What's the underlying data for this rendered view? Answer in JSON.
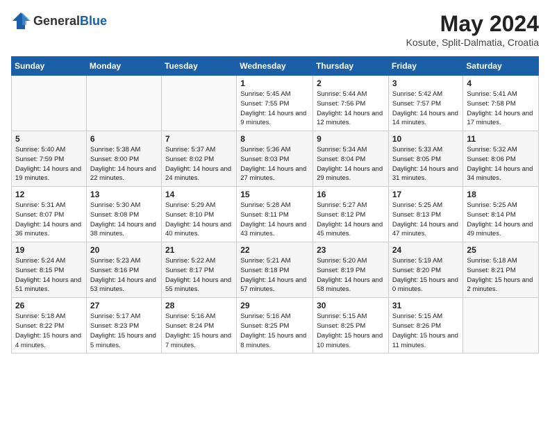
{
  "header": {
    "logo_general": "General",
    "logo_blue": "Blue",
    "month_year": "May 2024",
    "location": "Kosute, Split-Dalmatia, Croatia"
  },
  "weekdays": [
    "Sunday",
    "Monday",
    "Tuesday",
    "Wednesday",
    "Thursday",
    "Friday",
    "Saturday"
  ],
  "weeks": [
    [
      {
        "day": "",
        "info": ""
      },
      {
        "day": "",
        "info": ""
      },
      {
        "day": "",
        "info": ""
      },
      {
        "day": "1",
        "info": "Sunrise: 5:45 AM\nSunset: 7:55 PM\nDaylight: 14 hours\nand 9 minutes."
      },
      {
        "day": "2",
        "info": "Sunrise: 5:44 AM\nSunset: 7:56 PM\nDaylight: 14 hours\nand 12 minutes."
      },
      {
        "day": "3",
        "info": "Sunrise: 5:42 AM\nSunset: 7:57 PM\nDaylight: 14 hours\nand 14 minutes."
      },
      {
        "day": "4",
        "info": "Sunrise: 5:41 AM\nSunset: 7:58 PM\nDaylight: 14 hours\nand 17 minutes."
      }
    ],
    [
      {
        "day": "5",
        "info": "Sunrise: 5:40 AM\nSunset: 7:59 PM\nDaylight: 14 hours\nand 19 minutes."
      },
      {
        "day": "6",
        "info": "Sunrise: 5:38 AM\nSunset: 8:00 PM\nDaylight: 14 hours\nand 22 minutes."
      },
      {
        "day": "7",
        "info": "Sunrise: 5:37 AM\nSunset: 8:02 PM\nDaylight: 14 hours\nand 24 minutes."
      },
      {
        "day": "8",
        "info": "Sunrise: 5:36 AM\nSunset: 8:03 PM\nDaylight: 14 hours\nand 27 minutes."
      },
      {
        "day": "9",
        "info": "Sunrise: 5:34 AM\nSunset: 8:04 PM\nDaylight: 14 hours\nand 29 minutes."
      },
      {
        "day": "10",
        "info": "Sunrise: 5:33 AM\nSunset: 8:05 PM\nDaylight: 14 hours\nand 31 minutes."
      },
      {
        "day": "11",
        "info": "Sunrise: 5:32 AM\nSunset: 8:06 PM\nDaylight: 14 hours\nand 34 minutes."
      }
    ],
    [
      {
        "day": "12",
        "info": "Sunrise: 5:31 AM\nSunset: 8:07 PM\nDaylight: 14 hours\nand 36 minutes."
      },
      {
        "day": "13",
        "info": "Sunrise: 5:30 AM\nSunset: 8:08 PM\nDaylight: 14 hours\nand 38 minutes."
      },
      {
        "day": "14",
        "info": "Sunrise: 5:29 AM\nSunset: 8:10 PM\nDaylight: 14 hours\nand 40 minutes."
      },
      {
        "day": "15",
        "info": "Sunrise: 5:28 AM\nSunset: 8:11 PM\nDaylight: 14 hours\nand 43 minutes."
      },
      {
        "day": "16",
        "info": "Sunrise: 5:27 AM\nSunset: 8:12 PM\nDaylight: 14 hours\nand 45 minutes."
      },
      {
        "day": "17",
        "info": "Sunrise: 5:25 AM\nSunset: 8:13 PM\nDaylight: 14 hours\nand 47 minutes."
      },
      {
        "day": "18",
        "info": "Sunrise: 5:25 AM\nSunset: 8:14 PM\nDaylight: 14 hours\nand 49 minutes."
      }
    ],
    [
      {
        "day": "19",
        "info": "Sunrise: 5:24 AM\nSunset: 8:15 PM\nDaylight: 14 hours\nand 51 minutes."
      },
      {
        "day": "20",
        "info": "Sunrise: 5:23 AM\nSunset: 8:16 PM\nDaylight: 14 hours\nand 53 minutes."
      },
      {
        "day": "21",
        "info": "Sunrise: 5:22 AM\nSunset: 8:17 PM\nDaylight: 14 hours\nand 55 minutes."
      },
      {
        "day": "22",
        "info": "Sunrise: 5:21 AM\nSunset: 8:18 PM\nDaylight: 14 hours\nand 57 minutes."
      },
      {
        "day": "23",
        "info": "Sunrise: 5:20 AM\nSunset: 8:19 PM\nDaylight: 14 hours\nand 58 minutes."
      },
      {
        "day": "24",
        "info": "Sunrise: 5:19 AM\nSunset: 8:20 PM\nDaylight: 15 hours\nand 0 minutes."
      },
      {
        "day": "25",
        "info": "Sunrise: 5:18 AM\nSunset: 8:21 PM\nDaylight: 15 hours\nand 2 minutes."
      }
    ],
    [
      {
        "day": "26",
        "info": "Sunrise: 5:18 AM\nSunset: 8:22 PM\nDaylight: 15 hours\nand 4 minutes."
      },
      {
        "day": "27",
        "info": "Sunrise: 5:17 AM\nSunset: 8:23 PM\nDaylight: 15 hours\nand 5 minutes."
      },
      {
        "day": "28",
        "info": "Sunrise: 5:16 AM\nSunset: 8:24 PM\nDaylight: 15 hours\nand 7 minutes."
      },
      {
        "day": "29",
        "info": "Sunrise: 5:16 AM\nSunset: 8:25 PM\nDaylight: 15 hours\nand 8 minutes."
      },
      {
        "day": "30",
        "info": "Sunrise: 5:15 AM\nSunset: 8:25 PM\nDaylight: 15 hours\nand 10 minutes."
      },
      {
        "day": "31",
        "info": "Sunrise: 5:15 AM\nSunset: 8:26 PM\nDaylight: 15 hours\nand 11 minutes."
      },
      {
        "day": "",
        "info": ""
      }
    ]
  ]
}
